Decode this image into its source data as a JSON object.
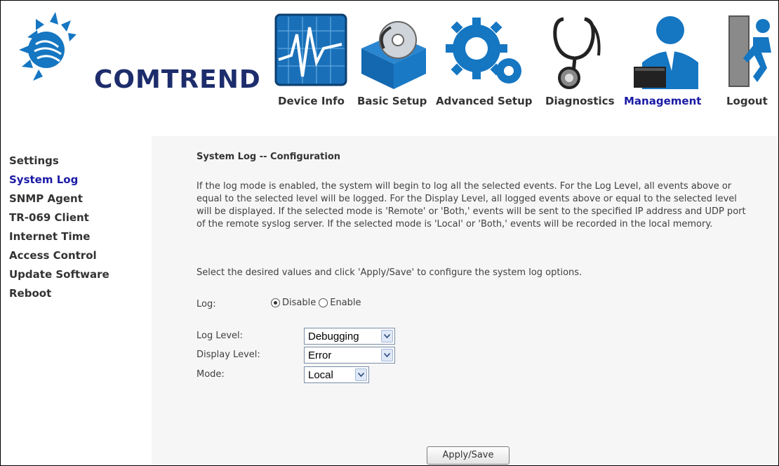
{
  "brand": {
    "name": "COMTREND"
  },
  "nav": {
    "items": [
      {
        "label": "Device Info",
        "icon": "pulse-chart-icon"
      },
      {
        "label": "Basic Setup",
        "icon": "setup-box-disc-icon"
      },
      {
        "label": "Advanced Setup",
        "icon": "gears-icon"
      },
      {
        "label": "Diagnostics",
        "icon": "stethoscope-icon"
      },
      {
        "label": "Management",
        "icon": "user-admin-icon",
        "active": true
      },
      {
        "label": "Logout",
        "icon": "exit-door-icon"
      }
    ]
  },
  "sidebar": {
    "items": [
      {
        "label": "Settings"
      },
      {
        "label": "System Log",
        "active": true
      },
      {
        "label": "SNMP Agent"
      },
      {
        "label": "TR-069 Client"
      },
      {
        "label": "Internet Time"
      },
      {
        "label": "Access Control"
      },
      {
        "label": "Update Software"
      },
      {
        "label": "Reboot"
      }
    ]
  },
  "main": {
    "title": "System Log -- Configuration",
    "description": "If the log mode is enabled, the system will begin to log all the selected events. For the Log Level, all events above or equal to the selected level will be logged. For the Display Level, all logged events above or equal to the selected level will be displayed. If the selected mode is 'Remote' or 'Both,' events will be sent to the specified IP address and UDP port of the remote syslog server. If the selected mode is 'Local' or 'Both,' events will be recorded in the local memory.",
    "instruction": "Select the desired values and click 'Apply/Save' to configure the system log options.",
    "log": {
      "label": "Log:",
      "options": [
        "Disable",
        "Enable"
      ],
      "selected": "Disable"
    },
    "log_level": {
      "label": "Log Level:",
      "value": "Debugging"
    },
    "display_level": {
      "label": "Display Level:",
      "value": "Error"
    },
    "mode": {
      "label": "Mode:",
      "value": "Local"
    },
    "apply_label": "Apply/Save"
  },
  "colors": {
    "brand": "#1d2d6c",
    "icon_blue": "#1576c2",
    "nav_active": "#1a1aa6",
    "content_bg": "#f6f6f6"
  }
}
